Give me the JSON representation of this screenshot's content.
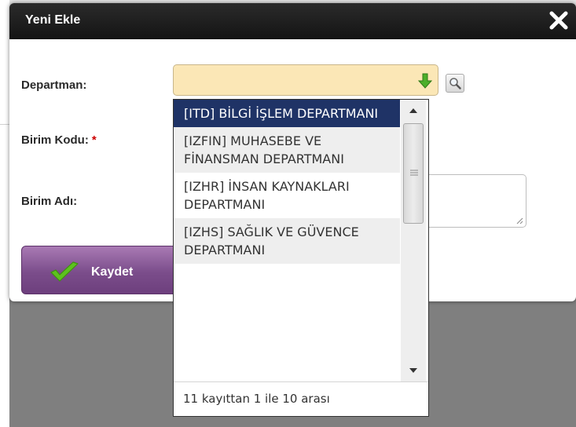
{
  "dialog": {
    "title": "Yeni Ekle",
    "close_icon": "close-icon"
  },
  "form": {
    "departman_label": "Departman:",
    "birim_kodu_label": "Birim Kodu:",
    "required_marker": "*",
    "birim_adi_label": "Birim Adı:",
    "departman_value": "",
    "birim_kodu_value": "",
    "birim_adi_value": ""
  },
  "save_button": {
    "label": "Kaydet",
    "icon": "checkmark-icon"
  },
  "dropdown": {
    "options": [
      "[ITD] BİLGİ İŞLEM DEPARTMANI",
      "[IZFIN] MUHASEBE VE FİNANSMAN DEPARTMANI",
      "[IZHR] İNSAN KAYNAKLARI DEPARTMANI",
      "[IZHS] SAĞLIK VE GÜVENCE DEPARTMANI"
    ],
    "selected_index": 0,
    "footer": "11 kayıttan 1 ile 10 arası"
  },
  "colors": {
    "titlebar": "#1c1c1c",
    "select_background": "#fbe7b6",
    "selected_option": "#1f3366",
    "save_button": "#7b4d8b",
    "arrow_green": "#4caf2a"
  }
}
